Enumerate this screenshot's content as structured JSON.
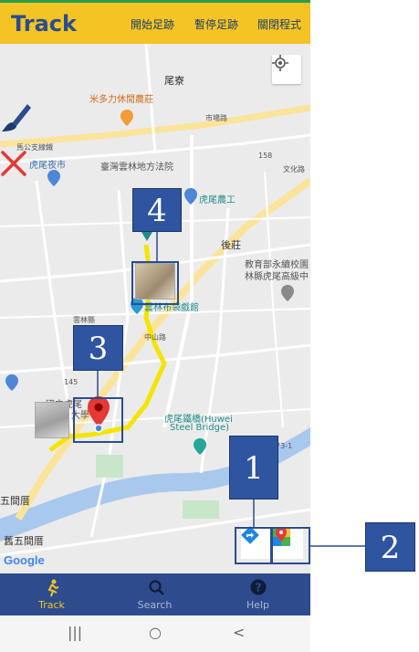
{
  "app": {
    "title": "Track",
    "actions": [
      "開始足跡",
      "暫停足跡",
      "關閉程式"
    ]
  },
  "map": {
    "labels": {
      "weiwei": "尾寮",
      "farm": "米多力休閒農莊",
      "road_shichang": "市場路",
      "road_magong": "馬公支線鐵",
      "night_market": "虎尾夜市",
      "court": "臺灣雲林地方法院",
      "huwei_farming": "虎尾農工",
      "wenhua": "文化路",
      "houzhuang": "後莊",
      "edu_school": "教育部永續校園",
      "huwei_high": "林縣虎尾高級中",
      "county_hall": "雲林布袋戲館",
      "yunlin": "雲林縣",
      "zhongshan": "中山路",
      "nat_huwei": "國立虎尾",
      "da_xue": "大學",
      "huwei_bridge_cn": "虎尾鐵橋(Huwei",
      "huwei_bridge_en": "Steel Bridge)",
      "wujian": "五間厝",
      "old_wujian": "舊五間厝",
      "route_158": "158",
      "route_145": "145",
      "route_73": "73-1",
      "google": "Google"
    },
    "icons": {
      "locate": "crosshair-icon",
      "brush": "paintbrush-icon",
      "clear": "red-x-icon",
      "route": "directions-icon",
      "gmaps": "google-maps-icon"
    }
  },
  "annotations": [
    "1",
    "2",
    "3",
    "4"
  ],
  "bottom_nav": [
    {
      "label": "Track",
      "icon": "runner-icon",
      "active": true
    },
    {
      "label": "Search",
      "icon": "search-icon",
      "active": false
    },
    {
      "label": "Help",
      "icon": "help-icon",
      "active": false
    }
  ],
  "system_nav": [
    "|||",
    "○",
    "<"
  ],
  "colors": {
    "topbar": "#f3c424",
    "title": "#2a4d8f",
    "bottom_nav": "#2e4c8d",
    "route": "#f5e400",
    "annotation": "#2f55a0"
  }
}
